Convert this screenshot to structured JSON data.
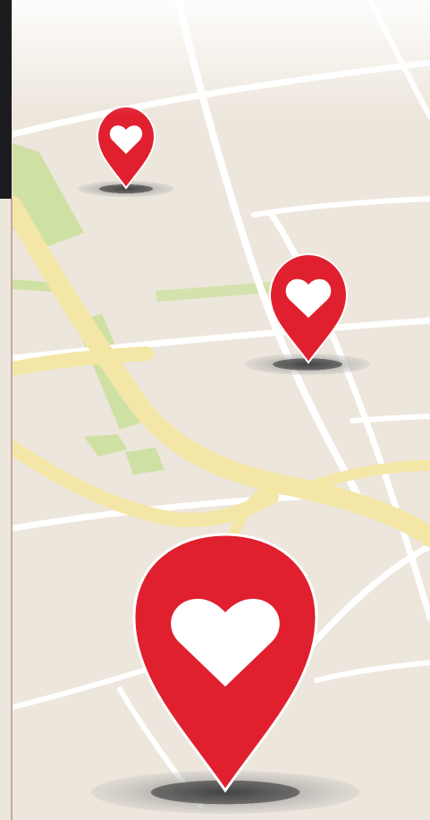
{
  "map": {
    "background_color": "#ede6dc",
    "street_color": "#ffffff",
    "highway_color": "#f4e6a6",
    "park_color": "#cfe0a4",
    "pin_color": "#e0202f",
    "pin_icon": "heart-icon",
    "markers": [
      {
        "name": "small"
      },
      {
        "name": "medium"
      },
      {
        "name": "large"
      }
    ]
  }
}
